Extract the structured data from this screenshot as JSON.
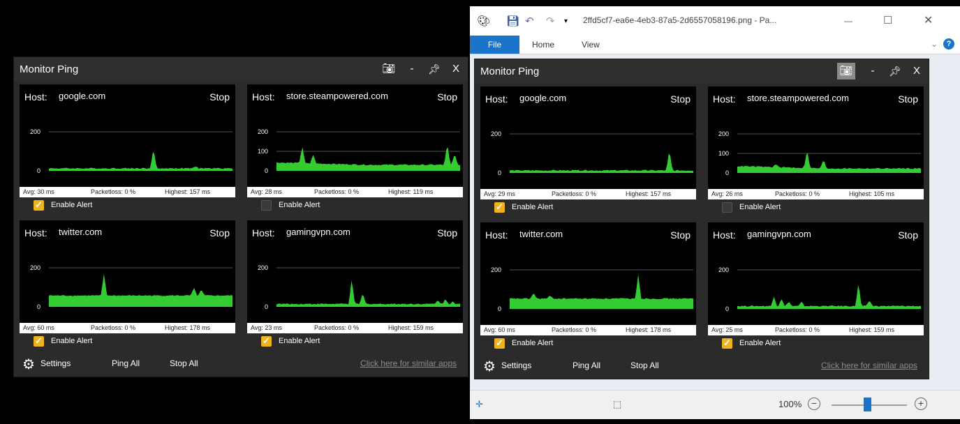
{
  "app": {
    "title": "Monitor Ping",
    "minimize": "-",
    "close": "X",
    "settings": "Settings",
    "ping_all": "Ping All",
    "stop_all": "Stop All",
    "similar_apps": "Click here for similar apps"
  },
  "colors": {
    "graph_fill": "#33cc33",
    "checkbox_on": "#f0b41a",
    "accent_blue": "#1a74c9"
  },
  "left_panels": [
    {
      "host_label": "Host:",
      "host": "google.com",
      "stop": "Stop",
      "ticks": [
        "200",
        "0"
      ],
      "avg": "Avg:  30 ms",
      "packetloss": "Packetloss:  0 %",
      "highest": "Highest:  157 ms",
      "alert_label": "Enable Alert",
      "alert_enabled": true
    },
    {
      "host_label": "Host:",
      "host": "store.steampowered.com",
      "stop": "Stop",
      "ticks": [
        "200",
        "100",
        "0"
      ],
      "avg": "Avg:  28 ms",
      "packetloss": "Packetloss:  0 %",
      "highest": "Highest:  119 ms",
      "alert_label": "Enable Alert",
      "alert_enabled": false
    },
    {
      "host_label": "Host:",
      "host": "twitter.com",
      "stop": "Stop",
      "ticks": [
        "200",
        "0"
      ],
      "avg": "Avg:  60 ms",
      "packetloss": "Packetloss:  0 %",
      "highest": "Highest:  178 ms",
      "alert_label": "Enable Alert",
      "alert_enabled": true
    },
    {
      "host_label": "Host:",
      "host": "gamingvpn.com",
      "stop": "Stop",
      "ticks": [
        "200",
        "0"
      ],
      "avg": "Avg:  23 ms",
      "packetloss": "Packetloss:  0 %",
      "highest": "Highest:  159 ms",
      "alert_label": "Enable Alert",
      "alert_enabled": true
    }
  ],
  "right_panels": [
    {
      "host_label": "Host:",
      "host": "google.com",
      "stop": "Stop",
      "ticks": [
        "200",
        "0"
      ],
      "avg": "Avg:  29 ms",
      "packetloss": "Packetloss:  0 %",
      "highest": "Highest:  157 ms",
      "alert_label": "Enable Alert",
      "alert_enabled": true
    },
    {
      "host_label": "Host:",
      "host": "store.steampowered.com",
      "stop": "Stop",
      "ticks": [
        "200",
        "100",
        "0"
      ],
      "avg": "Avg:  26 ms",
      "packetloss": "Packetloss:  0 %",
      "highest": "Highest:  105 ms",
      "alert_label": "Enable Alert",
      "alert_enabled": false
    },
    {
      "host_label": "Host:",
      "host": "twitter.com",
      "stop": "Stop",
      "ticks": [
        "200",
        "0"
      ],
      "avg": "Avg:  60 ms",
      "packetloss": "Packetloss:  0 %",
      "highest": "Highest:  178 ms",
      "alert_label": "Enable Alert",
      "alert_enabled": true
    },
    {
      "host_label": "Host:",
      "host": "gamingvpn.com",
      "stop": "Stop",
      "ticks": [
        "200",
        "0"
      ],
      "avg": "Avg:  25 ms",
      "packetloss": "Packetloss:  0 %",
      "highest": "Highest:  159 ms",
      "alert_label": "Enable Alert",
      "alert_enabled": true
    }
  ],
  "paint": {
    "title": "2ffd5cf7-ea6e-4eb3-87a5-2d6557058196.png - Pa...",
    "minimize": "—",
    "maximize": "☐",
    "close": "✕",
    "tabs": {
      "file": "File",
      "home": "Home",
      "view": "View"
    },
    "zoom": "100%",
    "zoom_level": 0.5
  }
}
